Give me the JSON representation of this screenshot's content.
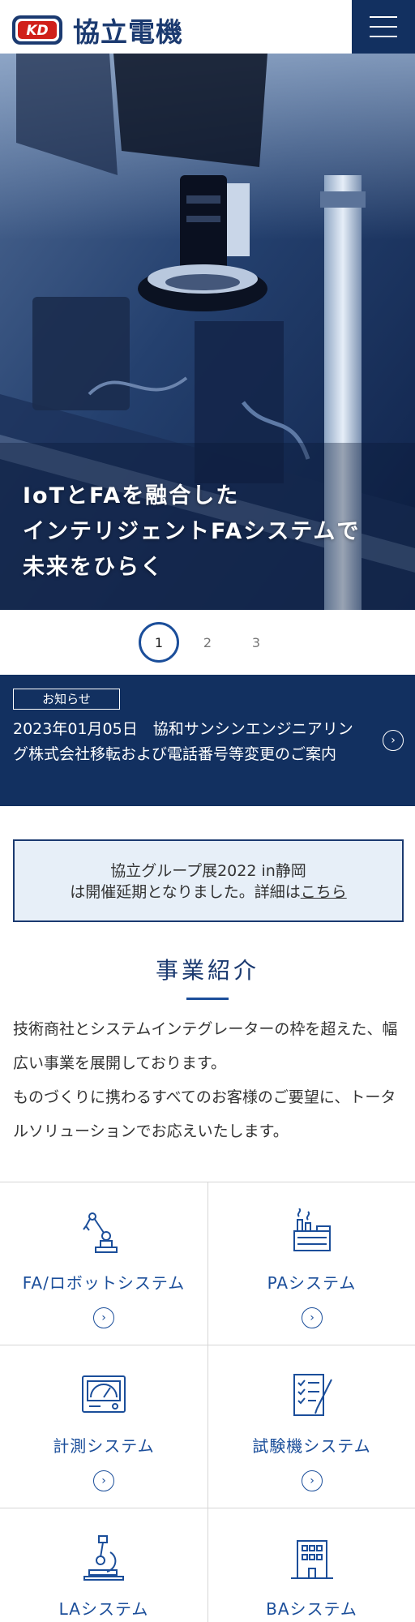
{
  "header": {
    "logo_mark": "KD",
    "logo_text": "協立電機",
    "menu_icon": "hamburger-icon"
  },
  "hero": {
    "line1": "IoTとFAを融合した",
    "line2": "インテリジェントFAシステムで",
    "line3": "未来をひらく"
  },
  "pager": {
    "pages": [
      "1",
      "2",
      "3"
    ],
    "active": "1"
  },
  "news": {
    "badge": "お知らせ",
    "text": "2023年01月05日　協和サンシンエンジニアリング株式会社移転および電話番号等変更のご案内",
    "arrow_icon": "chevron-right-circle-icon"
  },
  "notice": {
    "line1": "協立グループ展2022 in静岡",
    "line2_prefix": "は開催延期となりました。詳細は",
    "link_text": "こちら"
  },
  "business": {
    "title": "事業紹介",
    "intro1": "技術商社とシステムインテグレーターの枠を超えた、幅広い事業を展開しております。",
    "intro2": "ものづくりに携わるすべてのお客様のご要望に、トータルソリューションでお応えいたします。",
    "items": [
      {
        "label": "FA/ロボットシステム",
        "icon": "robot-arm-icon"
      },
      {
        "label": "PAシステム",
        "icon": "factory-icon"
      },
      {
        "label": "計測システム",
        "icon": "meter-icon"
      },
      {
        "label": "試験機システム",
        "icon": "checklist-icon"
      },
      {
        "label": "LAシステム",
        "icon": "microscope-icon"
      },
      {
        "label": "BAシステム",
        "icon": "building-icon"
      }
    ]
  },
  "colors": {
    "navy": "#123060",
    "brand_blue": "#1b4e9a",
    "logo_red": "#d0201a",
    "notice_bg": "#e7eff8"
  }
}
